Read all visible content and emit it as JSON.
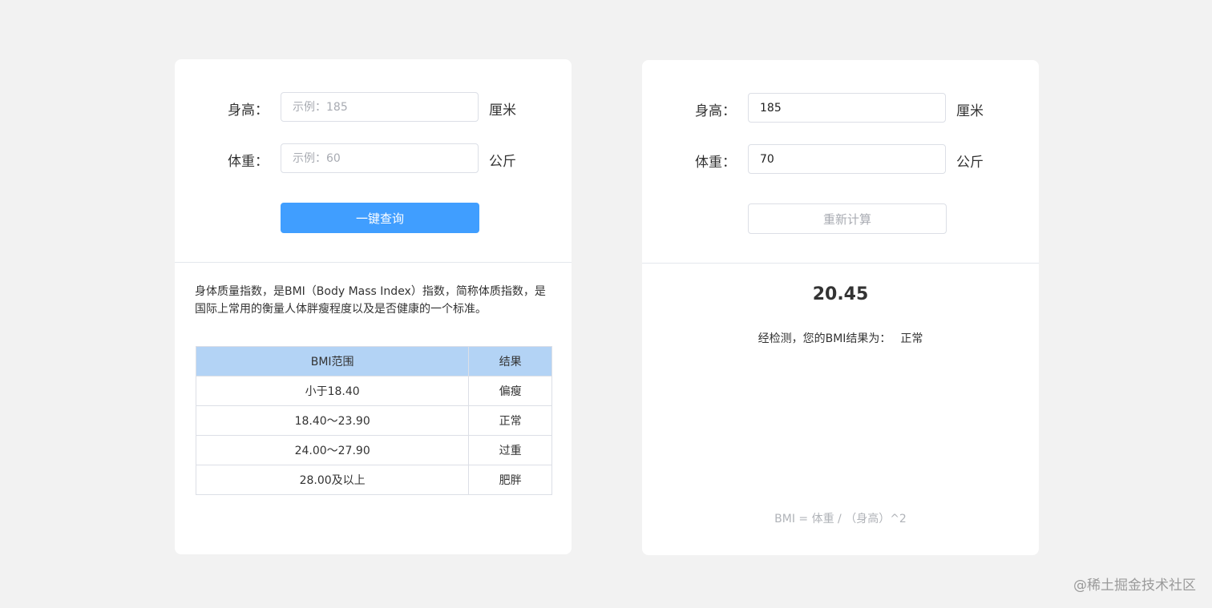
{
  "left_card": {
    "height": {
      "label": "身高：",
      "value": "",
      "placeholder": "示例：185",
      "unit": "厘米"
    },
    "weight": {
      "label": "体重：",
      "value": "",
      "placeholder": "示例：60",
      "unit": "公斤"
    },
    "query_button": "一键查询",
    "description": "身体质量指数，是BMI（Body Mass Index）指数，简称体质指数，是国际上常用的衡量人体胖瘦程度以及是否健康的一个标准。",
    "table": {
      "headers": [
        "BMI范围",
        "结果"
      ],
      "rows": [
        [
          "小于18.40",
          "偏瘦"
        ],
        [
          "18.40～23.90",
          "正常"
        ],
        [
          "24.00～27.90",
          "过重"
        ],
        [
          "28.00及以上",
          "肥胖"
        ]
      ]
    }
  },
  "right_card": {
    "height": {
      "label": "身高：",
      "value": "185",
      "placeholder": "示例：185",
      "unit": "厘米"
    },
    "weight": {
      "label": "体重：",
      "value": "70",
      "placeholder": "示例：60",
      "unit": "公斤"
    },
    "recalc_button": "重新计算",
    "bmi_value": "20.45",
    "result_label": "经检测，您的BMI结果为：",
    "result_value": "正常",
    "formula": "BMI = 体重 / （身高）^2"
  },
  "watermark": "@稀土掘金技术社区",
  "colors": {
    "primary": "#409eff",
    "table_header": "#b3d3f5",
    "background": "#f2f2f2"
  }
}
